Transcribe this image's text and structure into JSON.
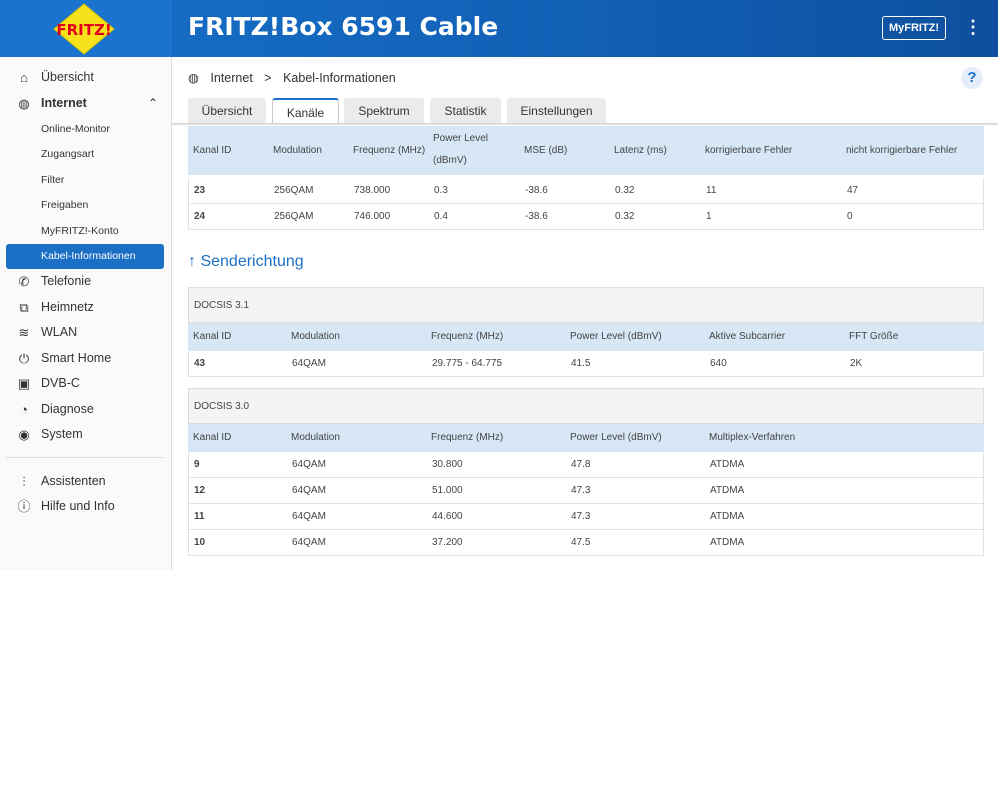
{
  "header": {
    "logo_text": "FRITZ!",
    "title": "FRITZ!Box 6591 Cable",
    "myfritz_label": "MyFRITZ!",
    "menu_icon": "kebab-icon"
  },
  "sidebar": {
    "items": [
      {
        "label": "Übersicht",
        "icon": "home-icon"
      },
      {
        "label": "Internet",
        "icon": "globe-icon"
      },
      {
        "label": "Online-Monitor"
      },
      {
        "label": "Zugangsart"
      },
      {
        "label": "Filter"
      },
      {
        "label": "Freigaben"
      },
      {
        "label": "MyFRITZ!-Konto"
      },
      {
        "label": "Kabel-Informationen"
      },
      {
        "label": "Telefonie",
        "icon": "phone-icon"
      },
      {
        "label": "Heimnetz",
        "icon": "network-icon"
      },
      {
        "label": "WLAN",
        "icon": "wifi-icon"
      },
      {
        "label": "Smart Home",
        "icon": "smart-home-icon"
      },
      {
        "label": "DVB-C",
        "icon": "tv-icon"
      },
      {
        "label": "Diagnose",
        "icon": "diagnose-icon"
      },
      {
        "label": "System",
        "icon": "system-icon"
      },
      {
        "label": "Assistenten",
        "icon": "wizard-icon"
      },
      {
        "label": "Hilfe und Info",
        "icon": "help-icon"
      }
    ]
  },
  "breadcrumb": {
    "root": "Internet",
    "separator": ">",
    "current": "Kabel-Informationen"
  },
  "help_label": "?",
  "tabs": [
    "Übersicht",
    "Kanäle",
    "Spektrum",
    "Statistik",
    "Einstellungen"
  ],
  "downstream": {
    "headers": [
      "Kanal ID",
      "Modulation",
      "Frequenz (MHz)",
      "Power Level (dBmV)",
      "MSE (dB)",
      "Latenz (ms)",
      "korrigierbare Fehler",
      "nicht korrigierbare Fehler"
    ],
    "rows": [
      [
        "23",
        "256QAM",
        "738.000",
        "0.3",
        "-38.6",
        "0.32",
        "11",
        "47"
      ],
      [
        "24",
        "256QAM",
        "746.000",
        "0.4",
        "-38.6",
        "0.32",
        "1",
        "0"
      ]
    ]
  },
  "upstream": {
    "title": "↑ Senderichtung",
    "docsis31": {
      "label": "DOCSIS 3.1",
      "headers": [
        "Kanal ID",
        "Modulation",
        "Frequenz (MHz)",
        "Power Level (dBmV)",
        "Aktive Subcarrier",
        "FFT Größe"
      ],
      "rows": [
        [
          "43",
          "64QAM",
          "29.775 - 64.775",
          "41.5",
          "640",
          "2K"
        ]
      ]
    },
    "docsis30": {
      "label": "DOCSIS 3.0",
      "headers": [
        "Kanal ID",
        "Modulation",
        "Frequenz (MHz)",
        "Power Level (dBmV)",
        "Multiplex-Verfahren"
      ],
      "rows": [
        [
          "9",
          "64QAM",
          "30.800",
          "47.8",
          "ATDMA"
        ],
        [
          "12",
          "64QAM",
          "51.000",
          "47.3",
          "ATDMA"
        ],
        [
          "11",
          "64QAM",
          "44.600",
          "47.3",
          "ATDMA"
        ],
        [
          "10",
          "64QAM",
          "37.200",
          "47.5",
          "ATDMA"
        ]
      ]
    }
  }
}
